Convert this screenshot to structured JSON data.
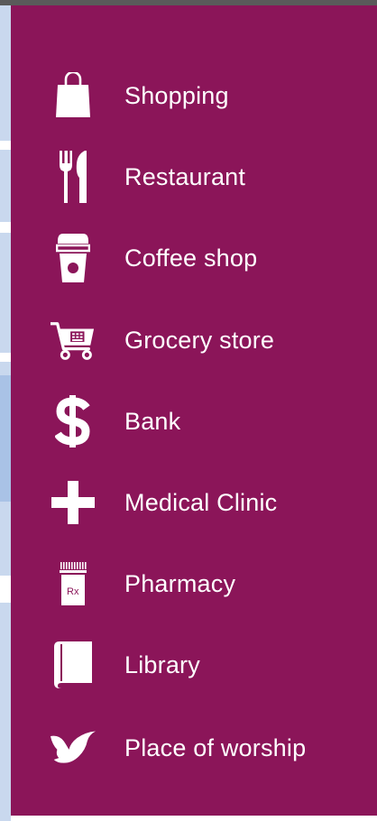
{
  "legend": {
    "items": [
      {
        "label": "Shopping",
        "icon": "shopping-bag-icon"
      },
      {
        "label": "Restaurant",
        "icon": "fork-knife-icon"
      },
      {
        "label": "Coffee shop",
        "icon": "coffee-cup-icon"
      },
      {
        "label": "Grocery store",
        "icon": "shopping-cart-icon"
      },
      {
        "label": "Bank",
        "icon": "dollar-sign-icon"
      },
      {
        "label": "Medical Clinic",
        "icon": "medical-cross-icon"
      },
      {
        "label": "Pharmacy",
        "icon": "pill-bottle-icon"
      },
      {
        "label": "Library",
        "icon": "book-icon"
      },
      {
        "label": "Place of worship",
        "icon": "dove-icon"
      }
    ],
    "colors": {
      "panel": "#8b1559",
      "text": "#ffffff",
      "icon": "#ffffff"
    }
  },
  "pharmacy_icon_text": "Rx"
}
